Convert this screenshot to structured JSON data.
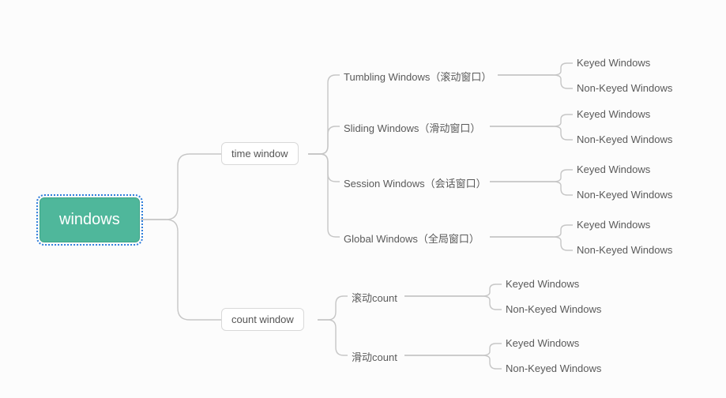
{
  "root": {
    "label": "windows"
  },
  "level1": {
    "time": {
      "label": "time window"
    },
    "count": {
      "label": "count window"
    }
  },
  "time_children": {
    "tumbling": {
      "label": "Tumbling Windows（滚动窗口）"
    },
    "sliding": {
      "label": "Sliding Windows（滑动窗口）"
    },
    "session": {
      "label": "Session Windows（会话窗口）"
    },
    "global": {
      "label": "Global Windows（全局窗口）"
    }
  },
  "count_children": {
    "gun": {
      "label": "滚动count"
    },
    "hua": {
      "label": "滑动count"
    }
  },
  "leaf_labels": {
    "keyed": "Keyed Windows",
    "nonkeyed": "Non-Keyed Windows"
  }
}
